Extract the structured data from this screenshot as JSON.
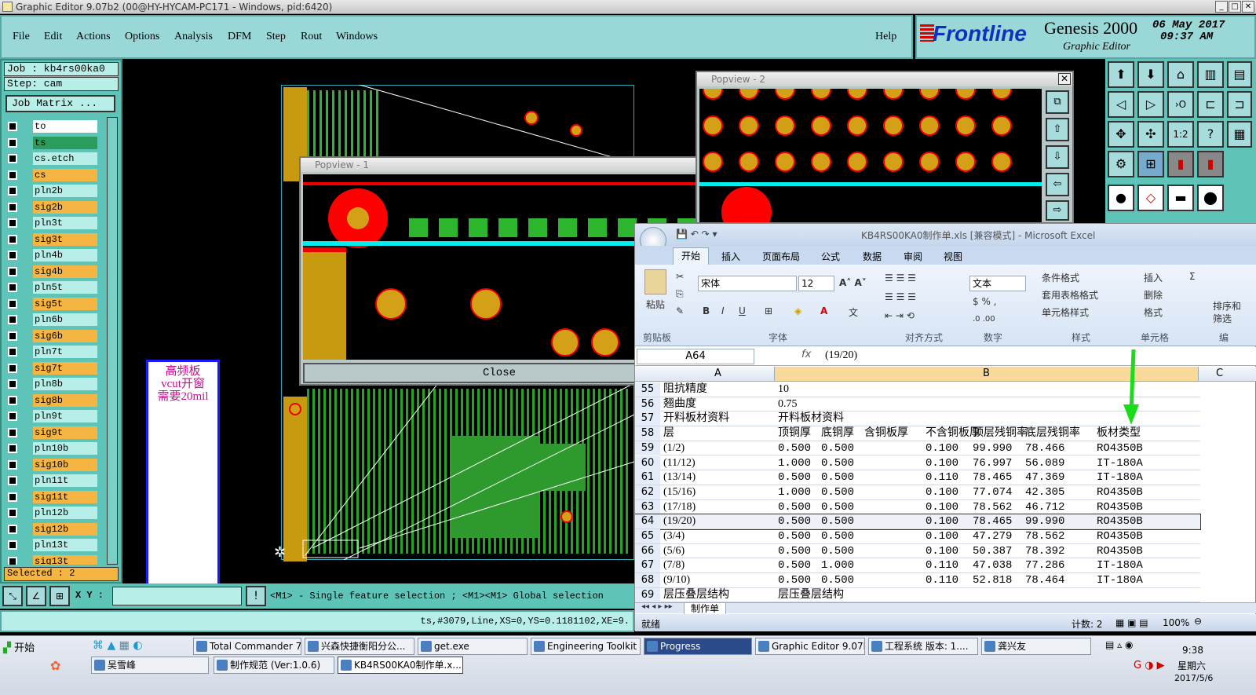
{
  "window": {
    "title": "Graphic Editor 9.07b2 (00@HY-HYCAM-PC171 - Windows, pid:6420)",
    "min": "_",
    "max": "□",
    "close": "✕"
  },
  "menu": {
    "items": [
      "File",
      "Edit",
      "Actions",
      "Options",
      "Analysis",
      "DFM",
      "Step",
      "Rout",
      "Windows"
    ],
    "help": "Help"
  },
  "brand": {
    "logo": "Frontline",
    "product": "Genesis 2000",
    "subtitle": "Graphic Editor",
    "date": "06 May 2017",
    "time": "09:37 AM"
  },
  "left": {
    "job": "Job : kb4rs00ka0",
    "step": "Step: cam",
    "matrix": "Job Matrix ...",
    "selected": "Selected : 2",
    "layers": [
      {
        "name": "to",
        "color": "#ffffff"
      },
      {
        "name": "ts",
        "color": "#2a9d5c"
      },
      {
        "name": "cs.etch",
        "color": "#b7efe8"
      },
      {
        "name": "cs",
        "color": "#f5b542"
      },
      {
        "name": "pln2b",
        "color": "#b7efe8"
      },
      {
        "name": "sig2b",
        "color": "#f5b542"
      },
      {
        "name": "pln3t",
        "color": "#b7efe8"
      },
      {
        "name": "sig3t",
        "color": "#f5b542"
      },
      {
        "name": "pln4b",
        "color": "#b7efe8"
      },
      {
        "name": "sig4b",
        "color": "#f5b542"
      },
      {
        "name": "pln5t",
        "color": "#b7efe8"
      },
      {
        "name": "sig5t",
        "color": "#f5b542"
      },
      {
        "name": "pln6b",
        "color": "#b7efe8"
      },
      {
        "name": "sig6b",
        "color": "#f5b542"
      },
      {
        "name": "pln7t",
        "color": "#b7efe8"
      },
      {
        "name": "sig7t",
        "color": "#f5b542"
      },
      {
        "name": "pln8b",
        "color": "#b7efe8"
      },
      {
        "name": "sig8b",
        "color": "#f5b542"
      },
      {
        "name": "pln9t",
        "color": "#b7efe8"
      },
      {
        "name": "sig9t",
        "color": "#f5b542"
      },
      {
        "name": "pln10b",
        "color": "#b7efe8"
      },
      {
        "name": "sig10b",
        "color": "#f5b542"
      },
      {
        "name": "pln11t",
        "color": "#b7efe8"
      },
      {
        "name": "sig11t",
        "color": "#f5b542"
      },
      {
        "name": "pln12b",
        "color": "#b7efe8"
      },
      {
        "name": "sig12b",
        "color": "#f5b542"
      },
      {
        "name": "pln13t",
        "color": "#b7efe8"
      },
      {
        "name": "sig13t",
        "color": "#f5b542"
      }
    ]
  },
  "note": {
    "text": "高频板\nvcut开窗\n需要20mil"
  },
  "popview1": {
    "title": "Popview - 1",
    "close": "Close"
  },
  "popview2": {
    "title": "Popview - 2"
  },
  "status": {
    "xy_label": "X Y :",
    "hint": "<M1> - Single feature selection ; <M1><M1> Global selection",
    "feature": "ts,#3079,Line,XS=0,YS=0.1181102,XE=9."
  },
  "excel": {
    "title": "KB4RS00KA0制作单.xls [兼容模式] - Microsoft Excel",
    "tabs": [
      "开始",
      "插入",
      "页面布局",
      "公式",
      "数据",
      "审阅",
      "视图"
    ],
    "font": "宋体",
    "size": "12",
    "numfmt": "文本",
    "groups": [
      "剪贴板",
      "字体",
      "对齐方式",
      "数字",
      "样式",
      "单元格"
    ],
    "paste": "粘贴",
    "styles": [
      "条件格式",
      "套用表格格式",
      "单元格样式"
    ],
    "cells_btns": [
      "插入",
      "删除",
      "格式"
    ],
    "edit_labels": [
      "排序和",
      "筛选",
      "编"
    ],
    "namebox": "A64",
    "formula": "(19/20)",
    "cols": [
      "A",
      "B",
      "C"
    ],
    "rows": [
      {
        "n": "55",
        "a": "阻抗精度",
        "b": [
          "10"
        ]
      },
      {
        "n": "56",
        "a": "翘曲度",
        "b": [
          "0.75"
        ]
      },
      {
        "n": "57",
        "a": "开料板材资料",
        "b": [
          "开料板材资料"
        ]
      },
      {
        "n": "58",
        "a": "层",
        "b": [
          "顶铜厚",
          "底铜厚",
          "含铜板厚",
          "不含铜板厚",
          "顶层残铜率",
          "底层残铜率",
          "板材类型"
        ]
      },
      {
        "n": "59",
        "a": "(1/2)",
        "b": [
          "0.500",
          "0.500",
          "",
          "0.100",
          "99.990",
          "78.466",
          "RO4350B"
        ]
      },
      {
        "n": "60",
        "a": "(11/12)",
        "b": [
          "1.000",
          "0.500",
          "",
          "0.100",
          "76.997",
          "56.089",
          "IT-180A"
        ]
      },
      {
        "n": "61",
        "a": "(13/14)",
        "b": [
          "0.500",
          "0.500",
          "",
          "0.110",
          "78.465",
          "47.369",
          "IT-180A"
        ]
      },
      {
        "n": "62",
        "a": "(15/16)",
        "b": [
          "1.000",
          "0.500",
          "",
          "0.100",
          "77.074",
          "42.305",
          "RO4350B"
        ]
      },
      {
        "n": "63",
        "a": "(17/18)",
        "b": [
          "0.500",
          "0.500",
          "",
          "0.100",
          "78.562",
          "46.712",
          "RO4350B"
        ]
      },
      {
        "n": "64",
        "a": "(19/20)",
        "b": [
          "0.500",
          "0.500",
          "",
          "0.100",
          "78.465",
          "99.990",
          "RO4350B"
        ]
      },
      {
        "n": "65",
        "a": "(3/4)",
        "b": [
          "0.500",
          "0.500",
          "",
          "0.100",
          "47.279",
          "78.562",
          "RO4350B"
        ]
      },
      {
        "n": "66",
        "a": "(5/6)",
        "b": [
          "0.500",
          "0.500",
          "",
          "0.100",
          "50.387",
          "78.392",
          "RO4350B"
        ]
      },
      {
        "n": "67",
        "a": "(7/8)",
        "b": [
          "0.500",
          "1.000",
          "",
          "0.110",
          "47.038",
          "77.286",
          "IT-180A"
        ]
      },
      {
        "n": "68",
        "a": "(9/10)",
        "b": [
          "0.500",
          "0.500",
          "",
          "0.110",
          "52.818",
          "78.464",
          "IT-180A"
        ]
      },
      {
        "n": "69",
        "a": "层压叠层结构",
        "b": [
          "层压叠层结构"
        ]
      }
    ],
    "sheet": "制作单",
    "ready": "就绪",
    "count": "计数: 2",
    "zoom": "100%"
  },
  "taskbar": {
    "start": "开始",
    "row1": [
      "Total Commander 7.0...",
      "兴森快捷衡阳分公...",
      "get.exe",
      "Engineering Toolkit 9....",
      "Progress",
      "Graphic Editor 9.07b2...",
      "工程系统  版本: 1....",
      "龚兴友"
    ],
    "row2": [
      "吴雪峰",
      "制作规范 (Ver:1.0.6)",
      "KB4RS00KA0制作单.x..."
    ],
    "clock": "9:38",
    "weekday": "星期六",
    "date": "2017/5/6"
  }
}
